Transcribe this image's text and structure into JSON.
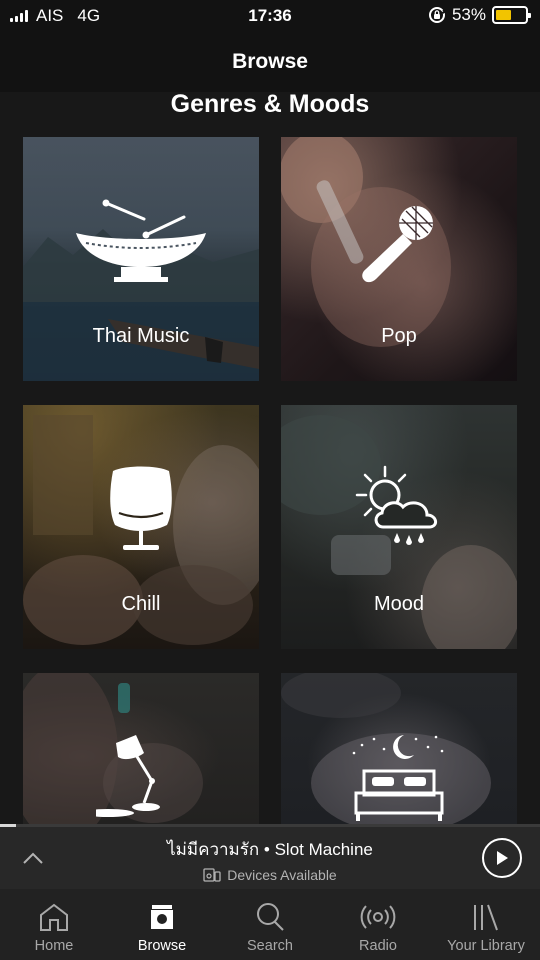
{
  "status_bar": {
    "carrier": "AIS",
    "network": "4G",
    "time": "17:36",
    "battery_percent": "53%",
    "battery_level": 0.53,
    "battery_color": "#f2c400"
  },
  "header": {
    "title": "Browse"
  },
  "section": {
    "title": "Genres & Moods"
  },
  "tiles": [
    {
      "label": "Thai Music",
      "icon": "thai-drum-icon"
    },
    {
      "label": "Pop",
      "icon": "microphone-icon"
    },
    {
      "label": "Chill",
      "icon": "egg-chair-icon"
    },
    {
      "label": "Mood",
      "icon": "sun-cloud-rain-icon"
    },
    {
      "label": "",
      "icon": "desk-lamp-icon"
    },
    {
      "label": "",
      "icon": "bed-moon-icon"
    }
  ],
  "now_playing": {
    "title": "ไม่มีความรัก • Slot Machine",
    "devices": "Devices Available",
    "progress": 0.03
  },
  "tabs": [
    {
      "label": "Home",
      "icon": "home-icon",
      "active": false
    },
    {
      "label": "Browse",
      "icon": "browse-icon",
      "active": true
    },
    {
      "label": "Search",
      "icon": "search-icon",
      "active": false
    },
    {
      "label": "Radio",
      "icon": "radio-icon",
      "active": false
    },
    {
      "label": "Your Library",
      "icon": "library-icon",
      "active": false
    }
  ]
}
